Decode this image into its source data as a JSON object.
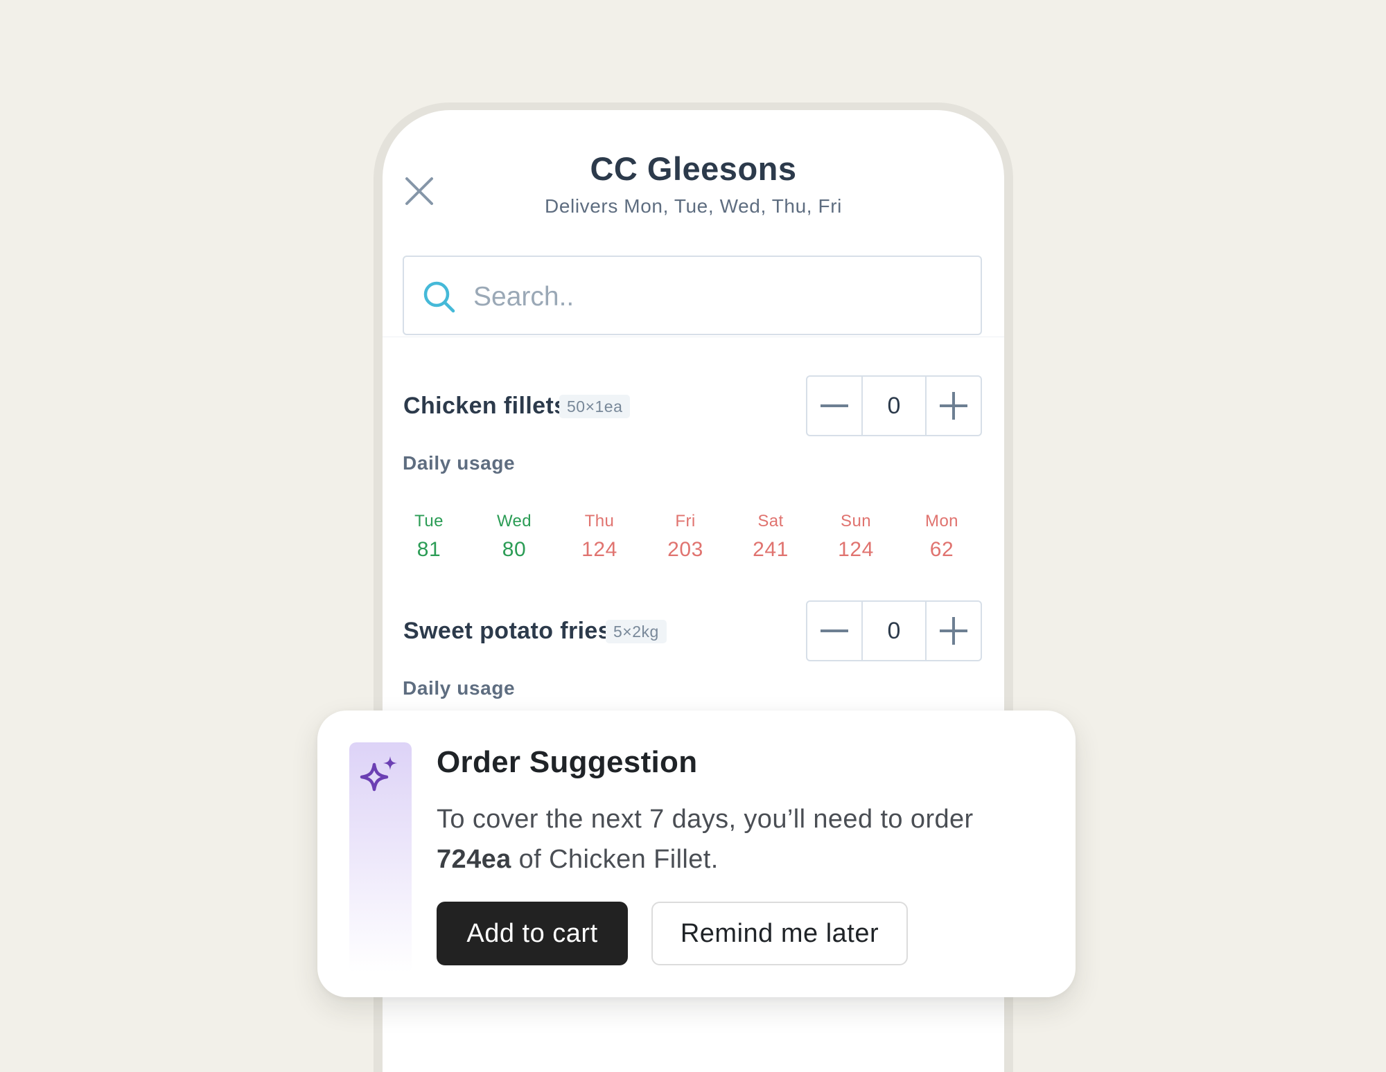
{
  "supplier": {
    "name": "CC Gleesons",
    "delivery_days": "Delivers Mon, Tue, Wed, Thu, Fri"
  },
  "search": {
    "placeholder": "Search..",
    "value": ""
  },
  "products": [
    {
      "name": "Chicken fillets",
      "pack": "50×1ea",
      "quantity": "0",
      "usage_label": "Daily usage",
      "usage": [
        {
          "day": "Tue",
          "value": "81",
          "status": "ok"
        },
        {
          "day": "Wed",
          "value": "80",
          "status": "ok"
        },
        {
          "day": "Thu",
          "value": "124",
          "status": "high"
        },
        {
          "day": "Fri",
          "value": "203",
          "status": "high"
        },
        {
          "day": "Sat",
          "value": "241",
          "status": "high"
        },
        {
          "day": "Sun",
          "value": "124",
          "status": "high"
        },
        {
          "day": "Mon",
          "value": "62",
          "status": "high"
        }
      ]
    },
    {
      "name": "Sweet potato fries",
      "pack": "5×2kg",
      "quantity": "0",
      "usage_label": "Daily usage"
    }
  ],
  "suggestion": {
    "title": "Order Suggestion",
    "body_prefix": "To cover the next 7 days, you’ll need to order ",
    "amount": "724ea",
    "body_suffix": " of Chicken Fillet.",
    "primary_label": "Add to cart",
    "secondary_label": "Remind me later"
  },
  "colors": {
    "usage_ok": "#2b9c55",
    "usage_high": "#e0736f",
    "accent_purple": "#6b3fb3"
  },
  "icons": {
    "close": "close-icon",
    "search": "search-icon",
    "minus": "minus-icon",
    "plus": "plus-icon",
    "sparkle": "sparkle-icon"
  }
}
